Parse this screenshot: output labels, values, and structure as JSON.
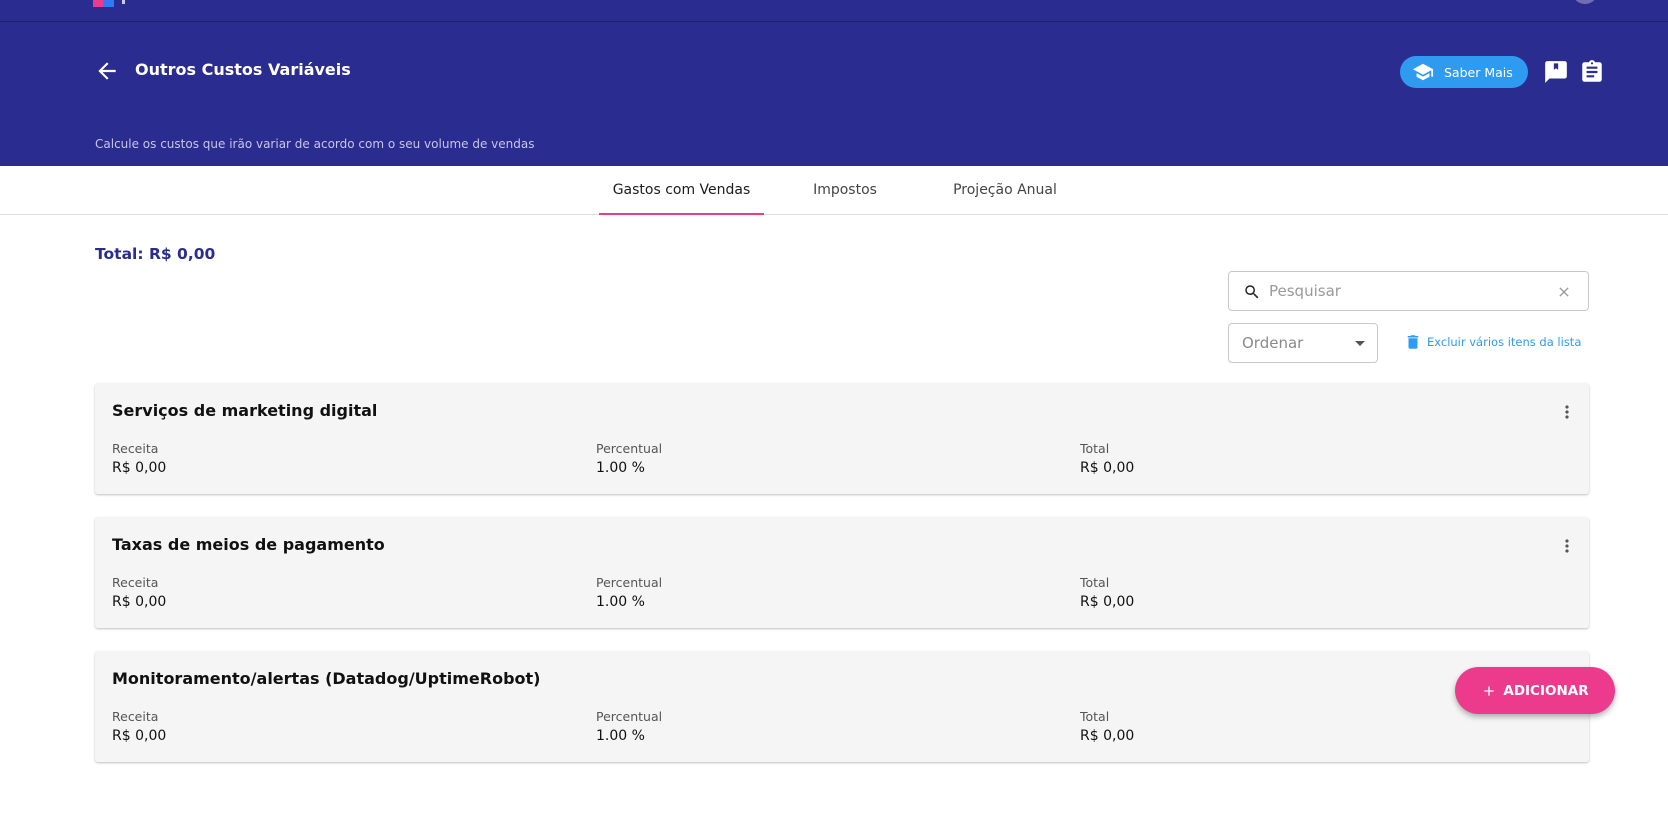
{
  "header": {
    "title": "Outros Custos Variáveis",
    "subtitle": "Calcule os custos que irão variar de acordo com o seu volume de vendas",
    "learn_more_label": "Saber Mais",
    "colors": {
      "header_bg": "#2b2c90",
      "learn_btn": "#2f9bf0"
    }
  },
  "tabs": [
    {
      "label": "Gastos com Vendas",
      "active": true
    },
    {
      "label": "Impostos",
      "active": false
    },
    {
      "label": "Projeção Anual",
      "active": false
    }
  ],
  "total_label": "Total: R$ 0,00",
  "search": {
    "placeholder": "Pesquisar",
    "value": ""
  },
  "sort": {
    "label": "Ordenar"
  },
  "bulk_delete_label": "Excluir vários itens da lista",
  "fields": {
    "revenue": "Receita",
    "percent": "Percentual",
    "total": "Total"
  },
  "items": [
    {
      "name": "Serviços de marketing digital",
      "revenue": "R$ 0,00",
      "percent": "1.00 %",
      "total": "R$ 0,00"
    },
    {
      "name": "Taxas de meios de pagamento",
      "revenue": "R$ 0,00",
      "percent": "1.00 %",
      "total": "R$ 0,00"
    },
    {
      "name": "Monitoramento/alertas (Datadog/UptimeRobot)",
      "revenue": "R$ 0,00",
      "percent": "1.00 %",
      "total": "R$ 0,00"
    }
  ],
  "add_button_label": "ADICIONAR",
  "accent_color": "#ec3a8d"
}
